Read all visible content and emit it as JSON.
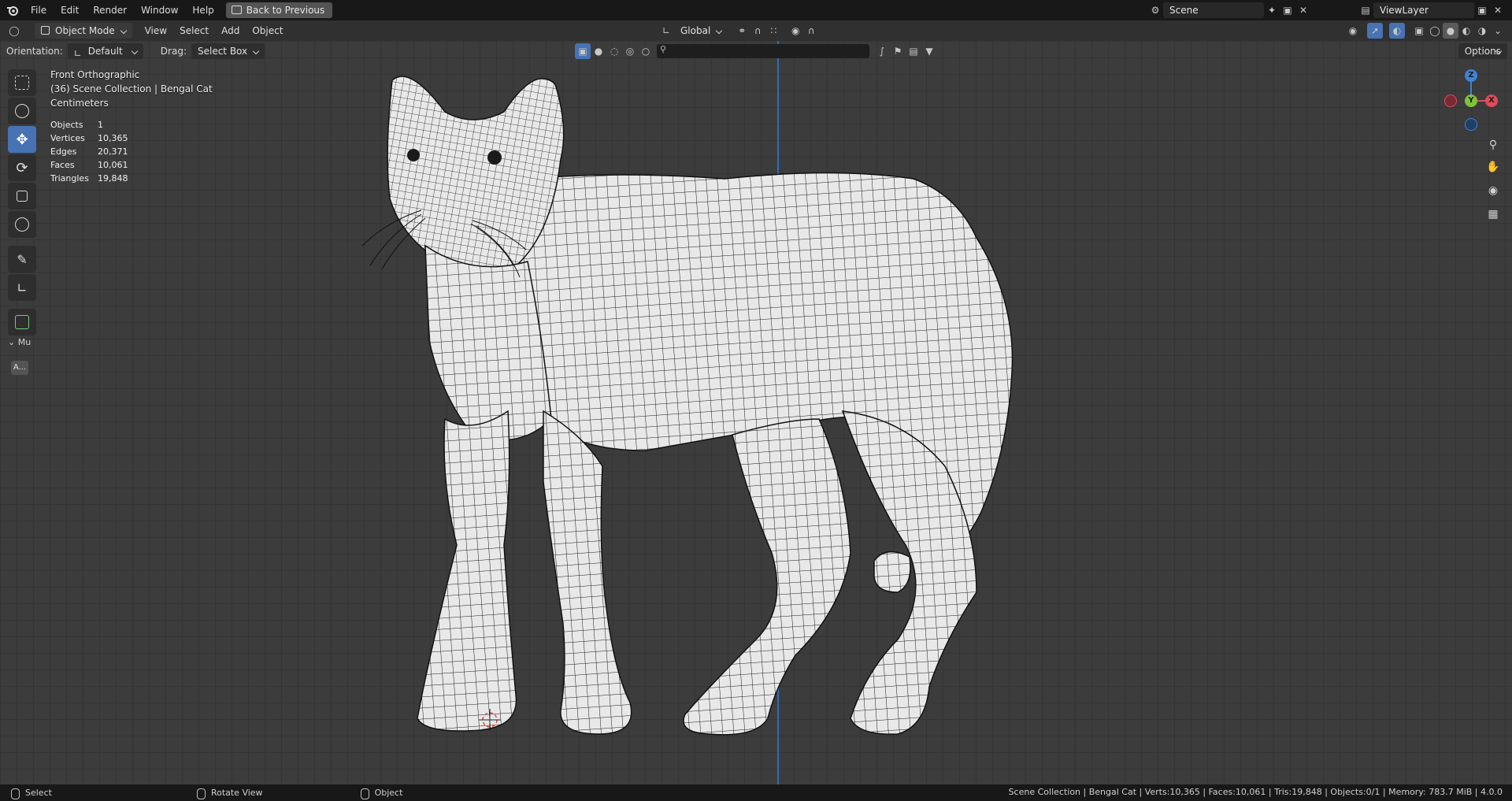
{
  "menubar": {
    "items": [
      "File",
      "Edit",
      "Render",
      "Window",
      "Help"
    ],
    "back_button": "Back to Previous",
    "scene": "Scene",
    "view_layer": "ViewLayer"
  },
  "header": {
    "mode": "Object Mode",
    "menus": [
      "View",
      "Select",
      "Add",
      "Object"
    ],
    "transform_orientation": "Global"
  },
  "tool_header": {
    "orientation_label": "Orientation:",
    "orientation_value": "Default",
    "drag_label": "Drag:",
    "drag_value": "Select Box",
    "options_label": "Options"
  },
  "overlay": {
    "view_name": "Front Orthographic",
    "collection": "(36) Scene Collection | Bengal Cat",
    "units": "Centimeters",
    "stats": [
      {
        "key": "Objects",
        "value": "1"
      },
      {
        "key": "Vertices",
        "value": "10,365"
      },
      {
        "key": "Edges",
        "value": "20,371"
      },
      {
        "key": "Faces",
        "value": "10,061"
      },
      {
        "key": "Triangles",
        "value": "19,848"
      }
    ]
  },
  "side_panel": {
    "panel_label": "Mu",
    "button_label": "A..."
  },
  "gizmo": {
    "x": "X",
    "y": "Y",
    "z": "Z"
  },
  "statusbar": {
    "left": [
      "Select",
      "Rotate View",
      "Object"
    ],
    "right": "Scene Collection | Bengal Cat | Verts:10,365 | Faces:10,061 | Tris:19,848 | Objects:0/1 | Memory: 783.7 MiB | 4.0.0"
  },
  "colors": {
    "accent": "#4772b3",
    "x_axis": "#e04a5a",
    "y_axis": "#7ec23a",
    "z_axis": "#3d83d9"
  }
}
